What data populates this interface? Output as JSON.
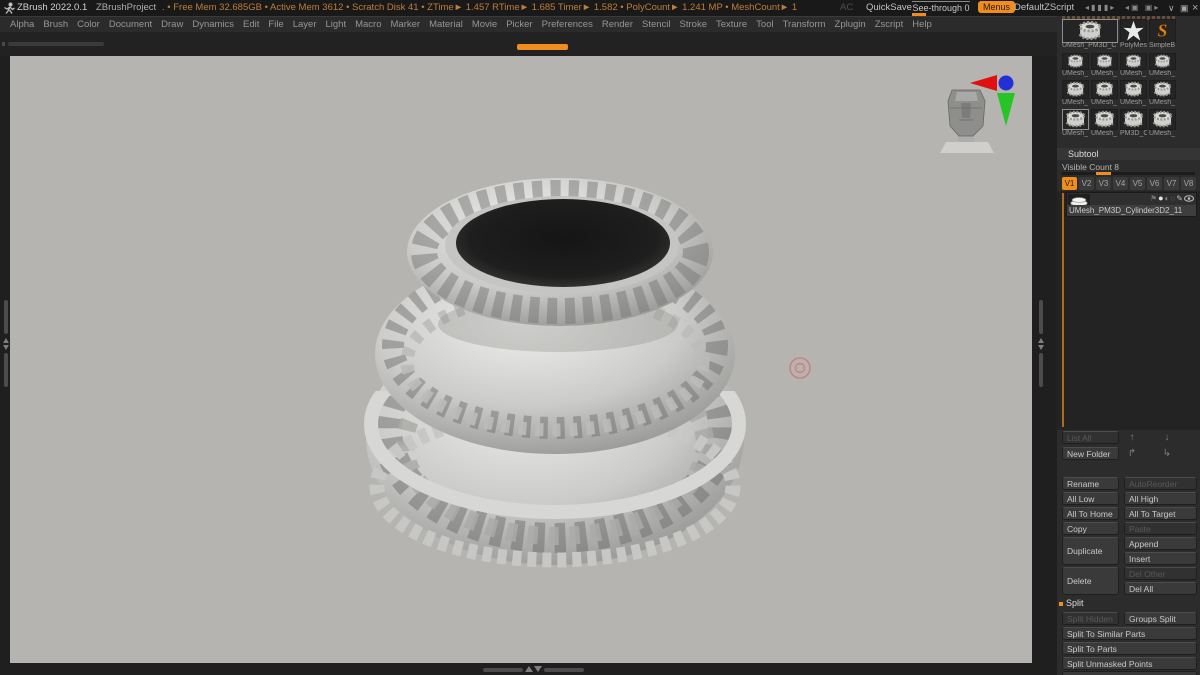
{
  "title_bar": {
    "app_title": "ZBrush 2022.0.1",
    "project": "ZBrushProject",
    "stats": ". • Free Mem 32.685GB • Active Mem 3612 • Scratch Disk 41 •  ZTime► 1.457 RTime► 1.685 Timer► 1.582 • PolyCount► 1.241 MP • MeshCount► 1",
    "ac": "AC",
    "quicksave": "QuickSave",
    "see_through_label": "See-through",
    "see_through_value": "0",
    "menus_button": "Menus",
    "default_zscript": "DefaultZScript"
  },
  "menu_bar": {
    "items": [
      "Alpha",
      "Brush",
      "Color",
      "Document",
      "Draw",
      "Dynamics",
      "Edit",
      "File",
      "Layer",
      "Light",
      "Macro",
      "Marker",
      "Material",
      "Movie",
      "Picker",
      "Preferences",
      "Render",
      "Stencil",
      "Stroke",
      "Texture",
      "Tool",
      "Transform",
      "Zplugin",
      "Zscript",
      "Help"
    ]
  },
  "tool_palette": {
    "selected_label": "UMesh_PM3D_C",
    "polymesh_label": "PolyMes",
    "simplebrush_label": "SimpleB",
    "grid": [
      "UMesh_",
      "UMesh_",
      "UMesh_",
      "UMesh_",
      "UMesh_",
      "UMesh_",
      "UMesh_",
      "UMesh_",
      "UMesh_",
      "UMesh_",
      "PM3D_C",
      "UMesh_"
    ]
  },
  "subtool": {
    "header": "Subtool",
    "visible_count_label": "Visible Count 8",
    "tabs": [
      "V1",
      "V2",
      "V3",
      "V4",
      "V5",
      "V6",
      "V7",
      "V8"
    ],
    "active_tab": "V1",
    "item_name": "UMesh_PM3D_Cylinder3D2_11"
  },
  "buttons": {
    "list_all": "List All",
    "new_folder": "New Folder",
    "rename": "Rename",
    "auto_reorder": "AutoReorder",
    "all_low": "All Low",
    "all_high": "All High",
    "all_to_home": "All To Home",
    "all_to_target": "All To Target",
    "copy": "Copy",
    "paste": "Paste",
    "duplicate": "Duplicate",
    "append": "Append",
    "insert": "Insert",
    "delete": "Delete",
    "del_other": "Del Other",
    "del_all": "Del All",
    "split_header": "Split",
    "split_hidden": "Split Hidden",
    "groups_split": "Groups Split",
    "split_to_similar_parts": "Split To Similar Parts",
    "split_to_parts": "Split To Parts",
    "split_unmasked_points": "Split Unmasked Points"
  },
  "icons": {
    "move_up": "↑",
    "move_down": "↓",
    "to_folder_up": "↱",
    "to_folder_down": "↳",
    "titlebar_tray_a": "◂▮▮▮▸",
    "titlebar_tray_b": "◂▣ ▣▸",
    "titlebar_min": "∨",
    "titlebar_restore": "▣",
    "titlebar_close": "×",
    "subtool_flag": "⚑",
    "subtool_dot": "●",
    "subtool_half": "◐",
    "subtool_ring": "○",
    "subtool_pen": "✎"
  },
  "colors": {
    "accent_orange": "#ef8e1e",
    "canvas_bg": "#b5b4b1",
    "panel_bg": "#2c2c2c",
    "stats_text": "#bd7d3c"
  }
}
